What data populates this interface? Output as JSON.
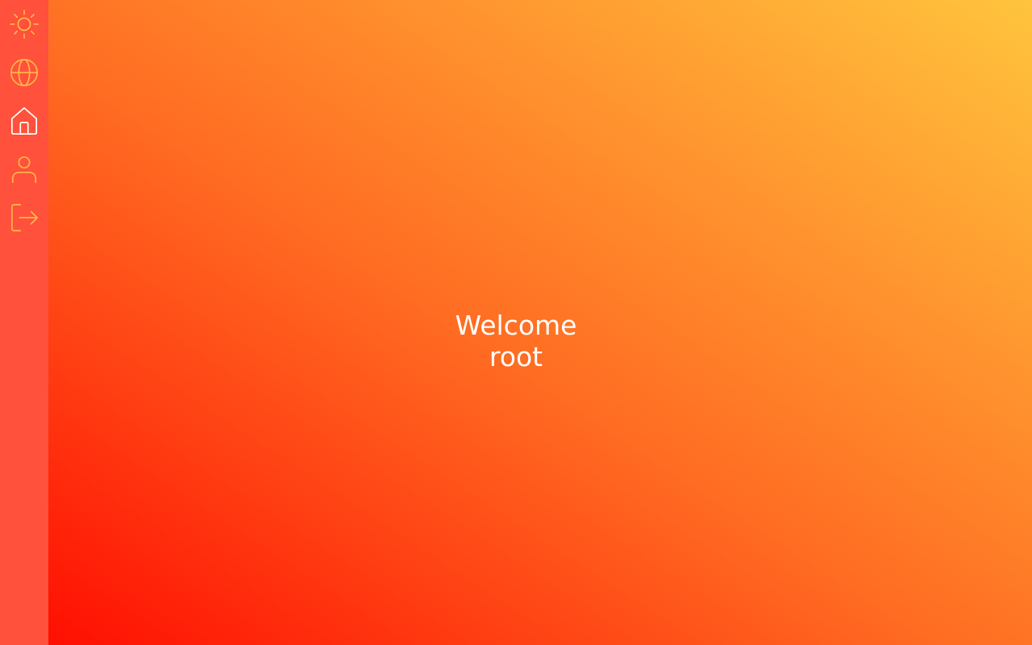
{
  "sidebar": {
    "items": [
      {
        "name": "theme",
        "icon": "sun-icon",
        "color": "#ffb84a",
        "active": false
      },
      {
        "name": "language",
        "icon": "globe-icon",
        "color": "#ffb84a",
        "active": false
      },
      {
        "name": "home",
        "icon": "home-icon",
        "color": "#ffffff",
        "active": true
      },
      {
        "name": "profile",
        "icon": "user-icon",
        "color": "#ffb84a",
        "active": false
      },
      {
        "name": "logout",
        "icon": "logout-icon",
        "color": "#ffb84a",
        "active": false
      }
    ]
  },
  "main": {
    "welcome_line1": "Welcome",
    "welcome_line2": "root"
  },
  "colors": {
    "sidebar_bg": "#ff513b",
    "gradient_bottom_left": "#ff0f02",
    "gradient_top_right": "#ffc43d",
    "icon_inactive": "#ffb84a",
    "icon_active": "#ffffff",
    "text": "#ffffff"
  }
}
